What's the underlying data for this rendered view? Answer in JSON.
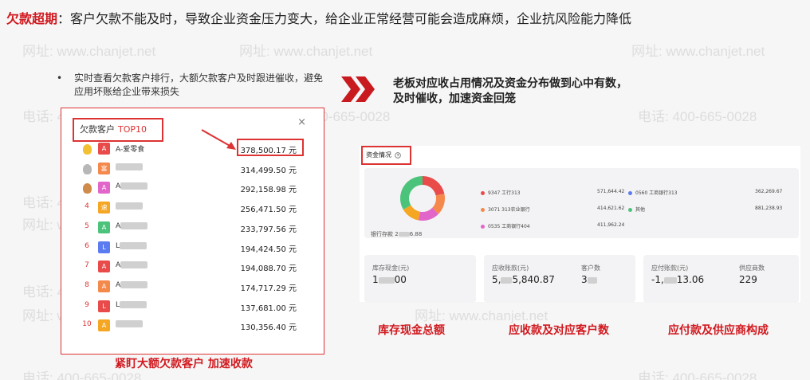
{
  "headline": {
    "key": "欠款超期",
    "sep": "：",
    "text": "客户欠款不能及时，导致企业资金压力变大，给企业正常经营可能会造成麻烦，企业抗风险能力降低"
  },
  "watermark": {
    "site": "网址: www.chanjet.net",
    "phone": "电话: 400-665-0028"
  },
  "bullet": {
    "dot": "•",
    "text": "实时查看欠款客户排行，大额欠款客户及时跟进催收，避免应用坏账给企业带来损失"
  },
  "panel": {
    "title": "欠款客户",
    "title_tag": "TOP10",
    "close": "×",
    "rows": [
      {
        "rank": "1",
        "avatar": "A",
        "name": "A-爱零食",
        "amount": "378,500.17 元"
      },
      {
        "rank": "2",
        "avatar": "富",
        "name": "",
        "amount": "314,499.50 元"
      },
      {
        "rank": "3",
        "avatar": "A",
        "name": "A",
        "amount": "292,158.98 元"
      },
      {
        "rank": "4",
        "avatar": "速",
        "name": "",
        "amount": "256,471.50 元"
      },
      {
        "rank": "5",
        "avatar": "A",
        "name": "A",
        "amount": "233,797.56 元"
      },
      {
        "rank": "6",
        "avatar": "L",
        "name": "L",
        "amount": "194,424.50 元"
      },
      {
        "rank": "7",
        "avatar": "A",
        "name": "A",
        "amount": "194,088.70 元"
      },
      {
        "rank": "8",
        "avatar": "A",
        "name": "A",
        "amount": "174,717.29 元"
      },
      {
        "rank": "9",
        "avatar": "L",
        "name": "L",
        "amount": "137,681.00 元"
      },
      {
        "rank": "10",
        "avatar": "A",
        "name": "",
        "amount": "130,356.40 元"
      }
    ],
    "avatar_colors": [
      "#e94b4b",
      "#f5894b",
      "#e266c9",
      "#f5a623",
      "#4cc37a",
      "#5b7cf0",
      "#e94b4b",
      "#f5894b",
      "#e94b4b",
      "#f5a623"
    ],
    "caption": "紧盯大额欠款客户  加速收款"
  },
  "callout": {
    "line1": "老板对应收占用情况及资金分布做到心中有数，",
    "line2": "及时催收，加速资金回笼"
  },
  "fund": {
    "title": "资金情况",
    "help_icon": "question-circle-icon",
    "donut_colors": [
      "#e94b4b",
      "#f5894b",
      "#e266c9",
      "#f5a623",
      "#4cc37a",
      "#5b7cf0"
    ],
    "bank_label": "银行存款",
    "bank_value_start": "2",
    "bank_value_end": "6.88",
    "legend": [
      {
        "label": "9347 工行313",
        "value": "571,644.42",
        "color": "#e94b4b"
      },
      {
        "label": "3071 313农业银行",
        "value": "414,621.62",
        "color": "#f5894b"
      },
      {
        "label": "0535 工商银行404",
        "value": "411,962.24",
        "color": "#e266c9"
      },
      {
        "label": "0560 工商银行313",
        "value": "362,269.67",
        "color": "#5b7cf0"
      },
      {
        "label": "其他",
        "value": "881,238.93",
        "color": "#4cc37a"
      }
    ],
    "stock": {
      "label": "库存现金(元)",
      "value_start": "1",
      "value_end": "00"
    },
    "receivable": {
      "label": "应收账款(元)",
      "value_start": "5,",
      "value_end": "5,840.87",
      "cust_label": "客户数",
      "cust_value": "3"
    },
    "payable": {
      "label": "应付账款(元)",
      "value_start": "-1,",
      "value_end": "13.06",
      "sup_label": "供应商数",
      "sup_value": "229"
    }
  },
  "captions": {
    "stock": "库存现金总额",
    "receivable": "应收款及对应客户数",
    "payable": "应付款及供应商构成"
  }
}
